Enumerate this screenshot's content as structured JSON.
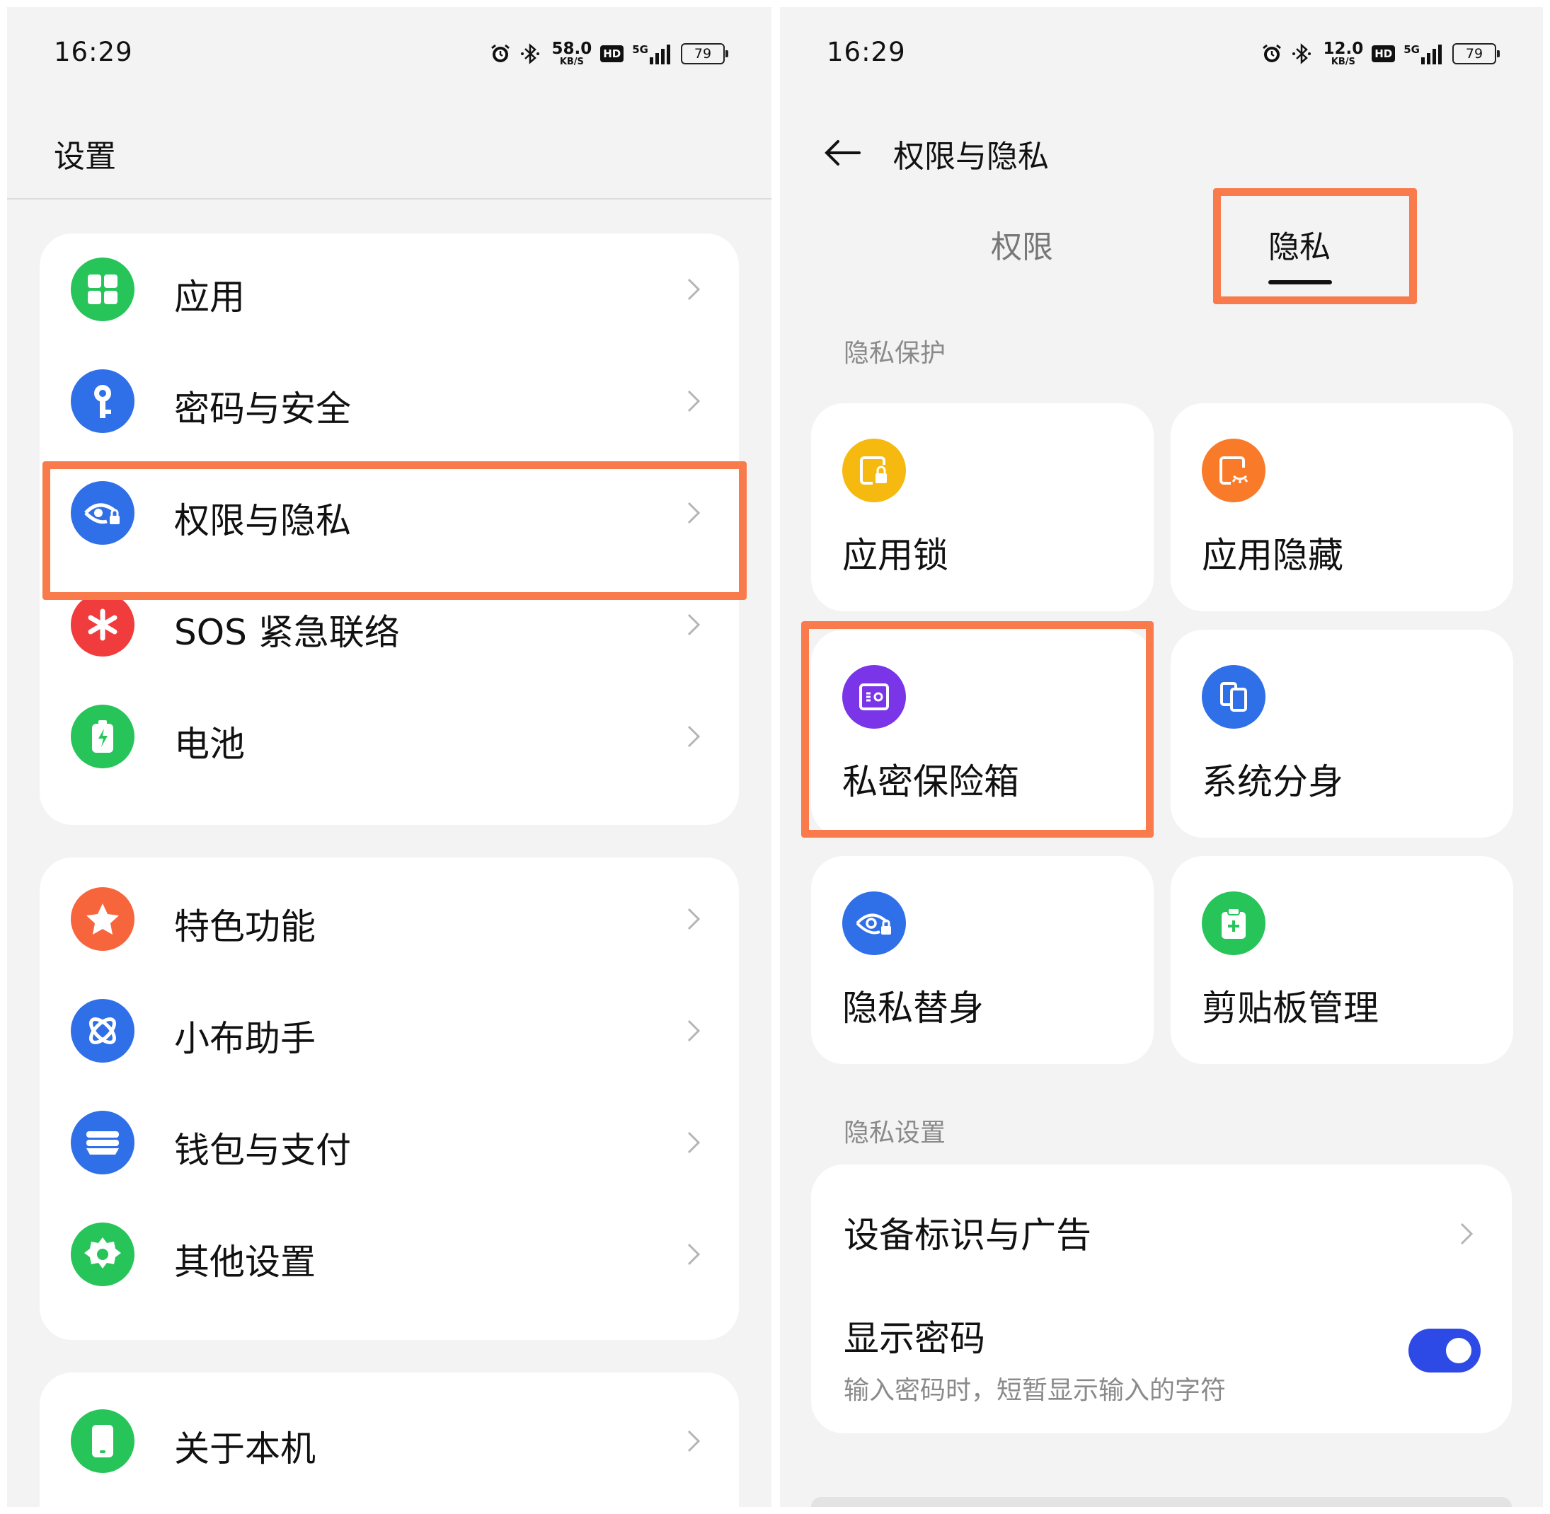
{
  "colors": {
    "highlight": "#f97a4b",
    "green": "#27c45a",
    "blue": "#2f6fe8",
    "red": "#f03c3c",
    "orange_red": "#f7653d",
    "yellow": "#f6b90f",
    "orange": "#f97b2a",
    "purple": "#7a35e8",
    "toggle_on": "#2d4ae6"
  },
  "left": {
    "status": {
      "time": "16:29",
      "speed_value": "58.0",
      "speed_unit": "KB/S",
      "hd": "HD",
      "net_type": "5G",
      "battery": "79"
    },
    "title": "设置",
    "groups": [
      {
        "items": [
          {
            "label": "应用",
            "icon": "apps-grid-icon"
          },
          {
            "label": "密码与安全",
            "icon": "key-icon"
          },
          {
            "label": "权限与隐私",
            "icon": "privacy-eye-lock-icon"
          },
          {
            "label": "SOS 紧急联络",
            "icon": "sos-asterisk-icon"
          },
          {
            "label": "电池",
            "icon": "battery-icon"
          }
        ]
      },
      {
        "items": [
          {
            "label": "特色功能",
            "icon": "star-icon"
          },
          {
            "label": "小布助手",
            "icon": "assistant-icon"
          },
          {
            "label": "钱包与支付",
            "icon": "wallet-icon"
          },
          {
            "label": "其他设置",
            "icon": "gear-icon"
          }
        ]
      },
      {
        "items": [
          {
            "label": "关于本机",
            "icon": "phone-icon"
          }
        ]
      }
    ]
  },
  "right": {
    "status": {
      "time": "16:29",
      "speed_value": "12.0",
      "speed_unit": "KB/S",
      "hd": "HD",
      "net_type": "5G",
      "battery": "79"
    },
    "title": "权限与隐私",
    "tabs": [
      {
        "label": "权限",
        "selected": false
      },
      {
        "label": "隐私",
        "selected": true
      }
    ],
    "section_protection": "隐私保护",
    "tiles": [
      {
        "label": "应用锁",
        "icon": "app-lock-icon"
      },
      {
        "label": "应用隐藏",
        "icon": "app-hide-icon"
      },
      {
        "label": "私密保险箱",
        "icon": "safe-icon"
      },
      {
        "label": "系统分身",
        "icon": "system-clone-icon"
      },
      {
        "label": "隐私替身",
        "icon": "privacy-substitute-icon"
      },
      {
        "label": "剪贴板管理",
        "icon": "clipboard-icon"
      }
    ],
    "section_settings": "隐私设置",
    "settings": {
      "device_id_ads": "设备标识与广告",
      "show_password": "显示密码",
      "show_password_desc": "输入密码时，短暂显示输入的字符",
      "show_password_on": true
    }
  }
}
